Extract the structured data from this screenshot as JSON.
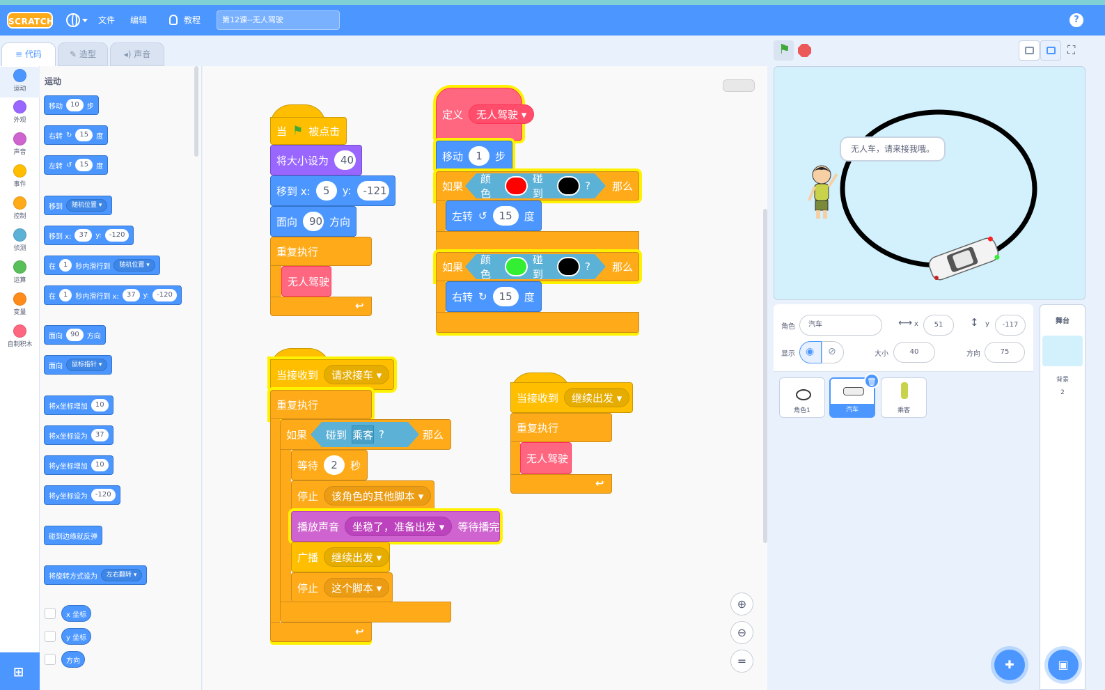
{
  "menubar": {
    "logo": "SCRATCH",
    "file": "文件",
    "edit": "编辑",
    "tutorials": "教程",
    "project_title": "第12课--无人驾驶",
    "help": "?"
  },
  "tabs": {
    "code": "代码",
    "costumes": "造型",
    "sounds": "声音"
  },
  "categories": [
    {
      "label": "运动",
      "color": "#4c97ff"
    },
    {
      "label": "外观",
      "color": "#9966ff"
    },
    {
      "label": "声音",
      "color": "#cf63cf"
    },
    {
      "label": "事件",
      "color": "#ffbf00"
    },
    {
      "label": "控制",
      "color": "#ffab19"
    },
    {
      "label": "侦测",
      "color": "#5cb1d6"
    },
    {
      "label": "运算",
      "color": "#59c059"
    },
    {
      "label": "变量",
      "color": "#ff8c1a"
    },
    {
      "label": "自制积木",
      "color": "#ff6680"
    }
  ],
  "palette": {
    "section": "运动",
    "move": {
      "a": "移动",
      "n": "10",
      "b": "步"
    },
    "turn_right": {
      "a": "右转",
      "n": "15",
      "b": "度"
    },
    "turn_left": {
      "a": "左转",
      "n": "15",
      "b": "度"
    },
    "goto": {
      "a": "移到",
      "dd": "随机位置"
    },
    "gotoxy": {
      "a": "移到 x:",
      "x": "37",
      "b": "y:",
      "y": "-120"
    },
    "glide": {
      "a": "在",
      "n": "1",
      "b": "秒内滑行到",
      "dd": "随机位置"
    },
    "glidexy": {
      "a": "在",
      "n": "1",
      "b": "秒内滑行到 x:",
      "x": "37",
      "c": "y:",
      "y": "-120"
    },
    "point": {
      "a": "面向",
      "n": "90",
      "b": "方向"
    },
    "point_towards": {
      "a": "面向",
      "dd": "鼠标指针"
    },
    "change_x": {
      "a": "将x坐标增加",
      "n": "10"
    },
    "set_x": {
      "a": "将x坐标设为",
      "n": "37"
    },
    "change_y": {
      "a": "将y坐标增加",
      "n": "10"
    },
    "set_y": {
      "a": "将y坐标设为",
      "n": "-120"
    },
    "bounce": "碰到边缘就反弹",
    "rotation": {
      "a": "将旋转方式设为",
      "dd": "左右翻转"
    },
    "xpos": "x 坐标",
    "ypos": "y 坐标",
    "direction": "方向"
  },
  "scripts": {
    "s1": {
      "hat_a": "当",
      "hat_b": "被点击",
      "size_a": "将大小设为",
      "size_n": "40",
      "goto_a": "移到 x:",
      "goto_x": "5",
      "goto_b": "y:",
      "goto_y": "-121",
      "dir_a": "面向",
      "dir_n": "90",
      "dir_b": "方向",
      "forever": "重复执行",
      "call": "无人驾驶"
    },
    "s2": {
      "define": "定义",
      "name": "无人驾驶",
      "move_a": "移动",
      "move_n": "1",
      "move_b": "步",
      "if1_a": "如果",
      "if1_color": "颜色",
      "if1_touch": "碰到",
      "if1_q": "?",
      "if1_then": "那么",
      "if1_swatch": "#ff0000",
      "if1_target": "#000000",
      "left_a": "左转",
      "left_n": "15",
      "left_b": "度",
      "if2_a": "如果",
      "if2_color": "颜色",
      "if2_touch": "碰到",
      "if2_q": "?",
      "if2_then": "那么",
      "if2_swatch": "#33ee33",
      "if2_target": "#000000",
      "right_a": "右转",
      "right_n": "15",
      "right_b": "度"
    },
    "s3": {
      "hat": "当接收到",
      "msg": "请求接车",
      "forever": "重复执行",
      "if_a": "如果",
      "touch": "碰到",
      "target": "乘客",
      "q": "?",
      "then": "那么",
      "wait_a": "等待",
      "wait_n": "2",
      "wait_b": "秒",
      "stop1_a": "停止",
      "stop1_dd": "该角色的其他脚本",
      "sound_a": "播放声音",
      "sound_dd": "坐稳了，准备出发",
      "sound_b": "等待播完",
      "bcast_a": "广播",
      "bcast_dd": "继续出发",
      "stop2_a": "停止",
      "stop2_dd": "这个脚本"
    },
    "s4": {
      "hat": "当接收到",
      "msg": "继续出发",
      "forever": "重复执行",
      "call": "无人驾驶"
    }
  },
  "stage": {
    "bubble": "无人车，请来接我哦。"
  },
  "sprite_info": {
    "sprite_label": "角色",
    "sprite_name": "汽车",
    "x_label": "x",
    "x": "51",
    "y_label": "y",
    "y": "-117",
    "show_label": "显示",
    "size_label": "大小",
    "size": "40",
    "dir_label": "方向",
    "dir": "75"
  },
  "sprites": [
    {
      "name": "角色1"
    },
    {
      "name": "汽车"
    },
    {
      "name": "乘客"
    }
  ],
  "stage_panel": {
    "title": "舞台",
    "backdrop_label": "背景",
    "backdrop_count": "2"
  }
}
